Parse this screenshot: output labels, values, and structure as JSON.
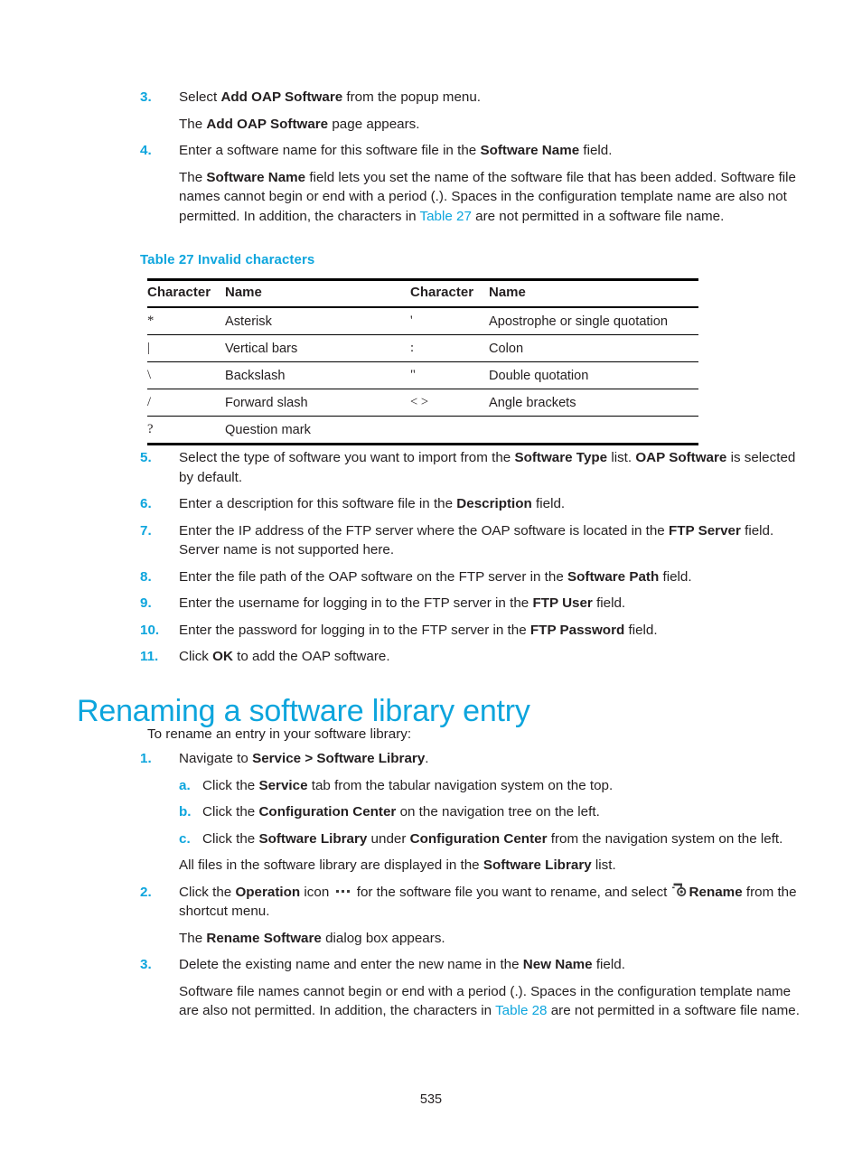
{
  "document": {
    "page_number": "535",
    "accent_color": "#0da5dd",
    "text_color": "#231f20"
  },
  "steps_top": [
    {
      "number": "3.",
      "text_parts": [
        {
          "t": "Select ",
          "style": "normal"
        },
        {
          "t": "Add OAP Software",
          "style": "bold"
        },
        {
          "t": " from the popup menu.",
          "style": "normal"
        }
      ]
    },
    {
      "number": "4.",
      "text_parts": [
        {
          "t": "Enter a software name for this software file in the ",
          "style": "normal"
        },
        {
          "t": "Software Name",
          "style": "bold"
        },
        {
          "t": " field.",
          "style": "normal"
        }
      ]
    }
  ],
  "continuations_top": {
    "after_step3": [
      {
        "t": "The ",
        "style": "normal"
      },
      {
        "t": "Add OAP Software",
        "style": "bold"
      },
      {
        "t": " page appears.",
        "style": "normal"
      }
    ],
    "after_step4": [
      {
        "t": "The ",
        "style": "normal"
      },
      {
        "t": "Software Name",
        "style": "bold"
      },
      {
        "t": " field lets you set the name of the software file that has been added. Software file names cannot begin or end with a period (.). Spaces in the configuration template name are also not permitted. In addition, the characters in ",
        "style": "normal"
      },
      {
        "t": "Table 27",
        "style": "xref"
      },
      {
        "t": " are not permitted in a software file name.",
        "style": "normal"
      }
    ]
  },
  "table": {
    "caption": "Table 27 Invalid characters",
    "headers": [
      "Character",
      "Name",
      "Character",
      "Name"
    ],
    "rows": [
      [
        "*",
        "Asterisk",
        "'",
        "Apostrophe or single quotation"
      ],
      [
        "|",
        "Vertical bars",
        ":",
        "Colon"
      ],
      [
        "\\",
        "Backslash",
        "\"",
        "Double quotation"
      ],
      [
        "/",
        "Forward slash",
        "< >",
        "Angle brackets"
      ],
      [
        "?",
        "Question mark",
        "",
        ""
      ]
    ]
  },
  "steps_mid": [
    {
      "number": "5.",
      "text_parts": [
        {
          "t": "Select the type of software you want to import from the ",
          "style": "normal"
        },
        {
          "t": "Software Type",
          "style": "bold"
        },
        {
          "t": " list. ",
          "style": "normal"
        },
        {
          "t": "OAP Software",
          "style": "bold"
        },
        {
          "t": " is selected by default.",
          "style": "normal"
        }
      ]
    },
    {
      "number": "6.",
      "text_parts": [
        {
          "t": "Enter a description for this software file in the ",
          "style": "normal"
        },
        {
          "t": "Description",
          "style": "bold"
        },
        {
          "t": " field.",
          "style": "normal"
        }
      ]
    },
    {
      "number": "7.",
      "text_parts": [
        {
          "t": "Enter the IP address of the FTP server where the OAP software is located in the ",
          "style": "normal"
        },
        {
          "t": "FTP Server",
          "style": "bold"
        },
        {
          "t": " field. Server name is not supported here.",
          "style": "normal"
        }
      ]
    },
    {
      "number": "8.",
      "text_parts": [
        {
          "t": "Enter the file path of the OAP software on the FTP server in the ",
          "style": "normal"
        },
        {
          "t": "Software Path",
          "style": "bold"
        },
        {
          "t": " field.",
          "style": "normal"
        }
      ]
    },
    {
      "number": "9.",
      "text_parts": [
        {
          "t": "Enter the username for logging in to the FTP server in the ",
          "style": "normal"
        },
        {
          "t": "FTP User",
          "style": "bold"
        },
        {
          "t": " field.",
          "style": "normal"
        }
      ]
    },
    {
      "number": "10.",
      "text_parts": [
        {
          "t": "Enter the password for logging in to the FTP server in the ",
          "style": "normal"
        },
        {
          "t": "FTP Password",
          "style": "bold"
        },
        {
          "t": " field.",
          "style": "normal"
        }
      ]
    },
    {
      "number": "11.",
      "text_parts": [
        {
          "t": "Click ",
          "style": "normal"
        },
        {
          "t": "OK",
          "style": "bold"
        },
        {
          "t": " to add the OAP software.",
          "style": "normal"
        }
      ]
    }
  ],
  "section": {
    "heading": "Renaming a software library entry",
    "intro": "To rename an entry in your software library:"
  },
  "steps_bottom": [
    {
      "number": "1.",
      "text_parts": [
        {
          "t": "Navigate to ",
          "style": "normal"
        },
        {
          "t": "Service > Software Library",
          "style": "bold"
        },
        {
          "t": ".",
          "style": "normal"
        }
      ]
    }
  ],
  "substeps": [
    {
      "letter": "a.",
      "text_parts": [
        {
          "t": "Click the ",
          "style": "normal"
        },
        {
          "t": "Service",
          "style": "bold"
        },
        {
          "t": " tab from the tabular navigation system on the top.",
          "style": "normal"
        }
      ]
    },
    {
      "letter": "b.",
      "text_parts": [
        {
          "t": "Click the ",
          "style": "normal"
        },
        {
          "t": "Configuration Center",
          "style": "bold"
        },
        {
          "t": " on the navigation tree on the left.",
          "style": "normal"
        }
      ]
    },
    {
      "letter": "c.",
      "text_parts": [
        {
          "t": "Click the ",
          "style": "normal"
        },
        {
          "t": "Software Library",
          "style": "bold"
        },
        {
          "t": " under ",
          "style": "normal"
        },
        {
          "t": "Configuration Center",
          "style": "bold"
        },
        {
          "t": " from the navigation system on the left.",
          "style": "normal"
        }
      ]
    }
  ],
  "continuations_bottom": {
    "after_substeps": [
      {
        "t": "All files in the software library are displayed in the ",
        "style": "normal"
      },
      {
        "t": "Software Library",
        "style": "bold"
      },
      {
        "t": " list.",
        "style": "normal"
      }
    ],
    "after_step2": [
      {
        "t": "The ",
        "style": "normal"
      },
      {
        "t": "Rename Software",
        "style": "bold"
      },
      {
        "t": " dialog box appears.",
        "style": "normal"
      }
    ],
    "after_step3": [
      {
        "t": "Software file names cannot begin or end with a period (.). Spaces in the configuration template name are also not permitted. In addition, the characters in ",
        "style": "normal"
      },
      {
        "t": "Table 28",
        "style": "xref"
      },
      {
        "t": " are not permitted in a software file name.",
        "style": "normal"
      }
    ]
  },
  "step2_bottom": {
    "number": "2.",
    "parts_before_ellipsis": [
      {
        "t": "Click the ",
        "style": "normal"
      },
      {
        "t": "Operation",
        "style": "bold"
      },
      {
        "t": " icon ",
        "style": "normal"
      }
    ],
    "ellipsis_icon": "ellipsis-icon",
    "parts_middle": [
      {
        "t": " for the software file you want to rename, and select ",
        "style": "normal"
      }
    ],
    "rename_icon": "rename-icon",
    "parts_after": [
      {
        "t": "Rename",
        "style": "bold"
      },
      {
        "t": " from the shortcut menu.",
        "style": "normal"
      }
    ]
  },
  "step3_bottom": {
    "number": "3.",
    "text_parts": [
      {
        "t": "Delete the existing name and enter the new name in the ",
        "style": "normal"
      },
      {
        "t": "New Name",
        "style": "bold"
      },
      {
        "t": " field.",
        "style": "normal"
      }
    ]
  }
}
